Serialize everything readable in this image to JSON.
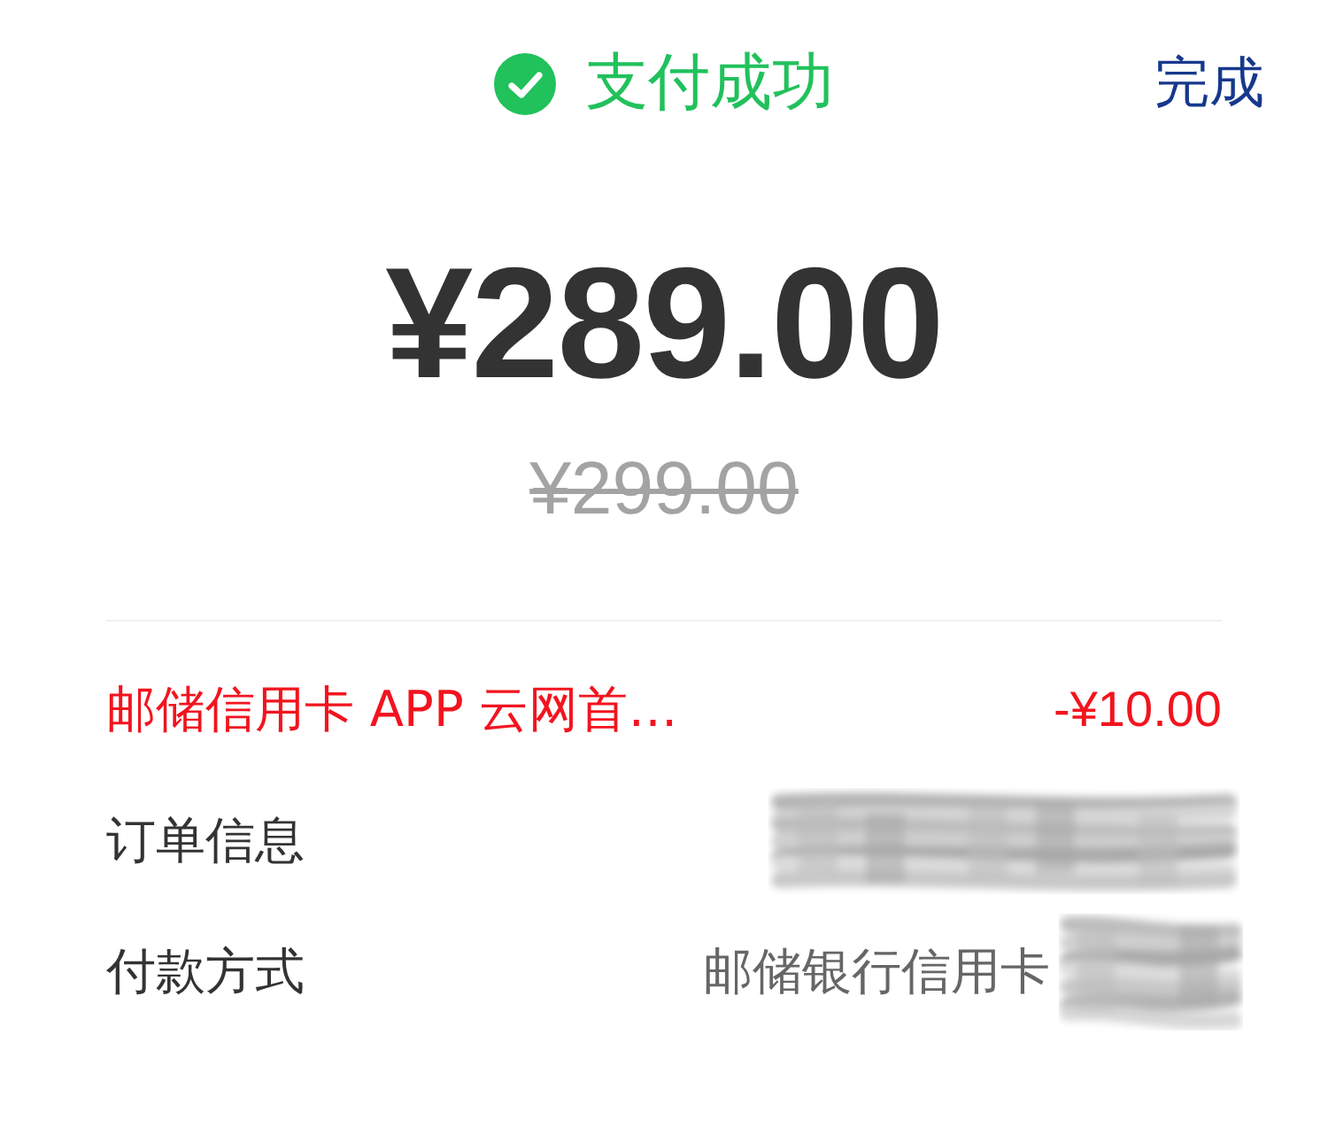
{
  "header": {
    "status": {
      "kind": "success",
      "title": "支付成功"
    },
    "done_button": "完成"
  },
  "amount": {
    "paid": "¥289.00",
    "original": "¥299.00"
  },
  "discount": {
    "label": "邮储信用卡 APP 云网首…",
    "value": "-¥10.00"
  },
  "details": [
    {
      "label": "订单信息",
      "redacted": true
    },
    {
      "label": "付款方式",
      "value": "邮储银行信用卡",
      "redacted": true
    }
  ]
}
